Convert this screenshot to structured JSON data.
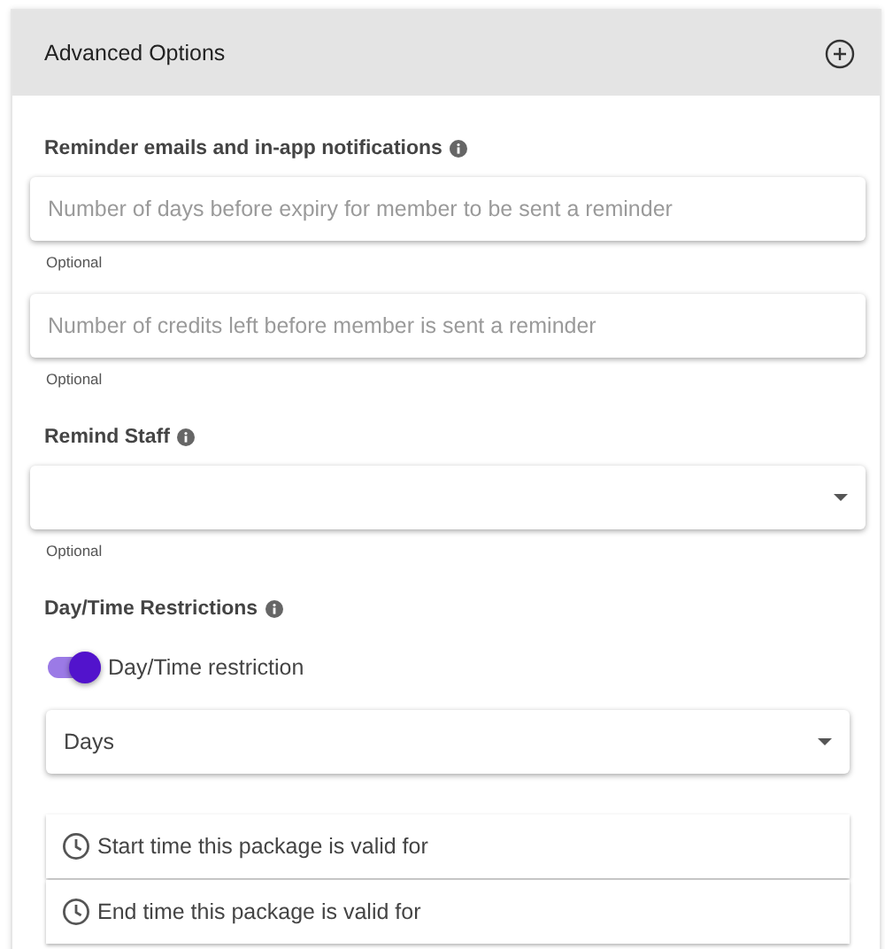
{
  "panel": {
    "title": "Advanced Options",
    "expanded": false
  },
  "reminders": {
    "label": "Reminder emails and in-app notifications",
    "fields": [
      {
        "placeholder": "Number of days before expiry for member to be sent a reminder",
        "helper": "Optional"
      },
      {
        "placeholder": "Number of credits left before member is sent a reminder",
        "helper": "Optional"
      }
    ]
  },
  "remind_staff": {
    "label": "Remind Staff",
    "helper": "Optional"
  },
  "restrictions": {
    "label": "Day/Time Restrictions",
    "toggle": {
      "label": "Day/Time restriction",
      "on": true
    },
    "select": {
      "value": "Days"
    },
    "time_fields": [
      {
        "placeholder": "Start time this package is valid for"
      },
      {
        "placeholder": "End time this package is valid for"
      }
    ]
  }
}
